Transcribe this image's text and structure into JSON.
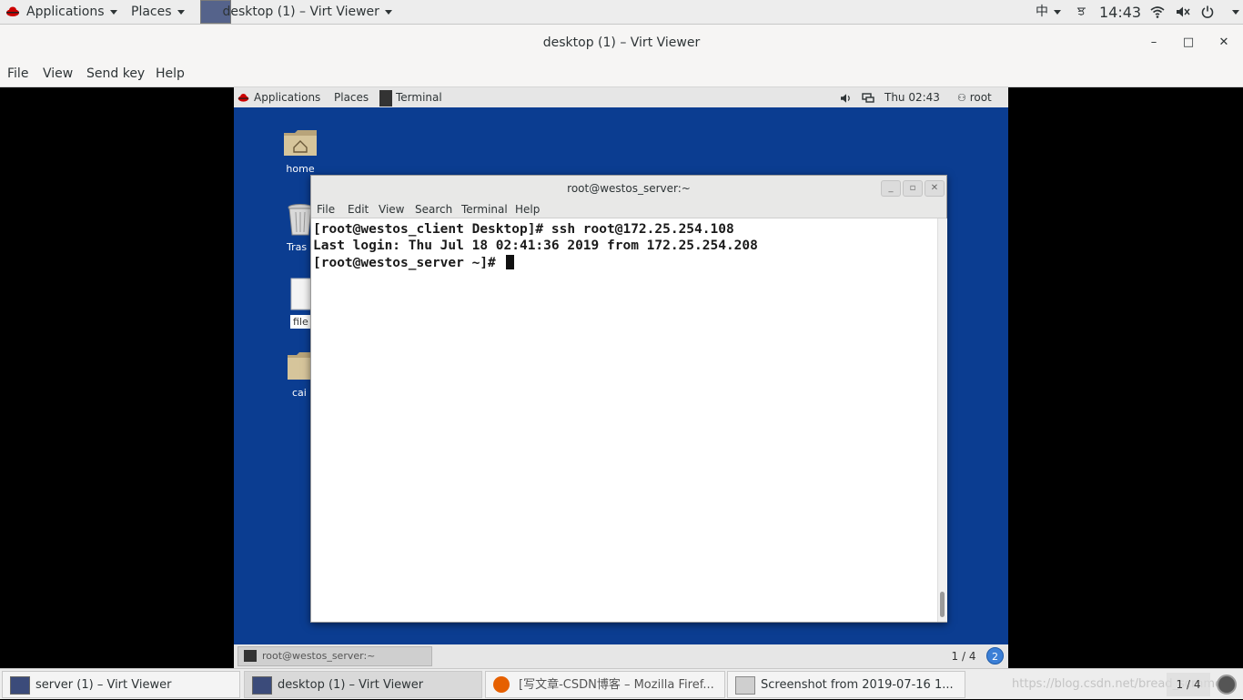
{
  "host_topbar": {
    "applications": "Applications",
    "places": "Places",
    "window_title": "desktop (1) – Virt Viewer",
    "input_method": "中",
    "keyboard": "ਝ",
    "clock": "14:43"
  },
  "virt_viewer": {
    "title": "desktop (1) – Virt Viewer",
    "menu": [
      "File",
      "View",
      "Send key",
      "Help"
    ],
    "minimize": "–",
    "maximize": "□",
    "close": "✕"
  },
  "guest": {
    "topbar": {
      "applications": "Applications",
      "places": "Places",
      "terminal": "Terminal",
      "clock": "Thu 02:43",
      "user": "root"
    },
    "desktop_icons": [
      "home",
      "Tras",
      "file",
      "cai"
    ],
    "terminal": {
      "title": "root@westos_server:~",
      "menu": [
        "File",
        "Edit",
        "View",
        "Search",
        "Terminal",
        "Help"
      ],
      "lines": [
        "[root@westos_client Desktop]# ssh root@172.25.254.108",
        "Last login: Thu Jul 18 02:41:36 2019 from 172.25.254.208",
        "[root@westos_server ~]# "
      ]
    },
    "bottombar": {
      "task": "root@westos_server:~",
      "workspace": "1 / 4",
      "badge": "2"
    }
  },
  "host_taskbar": {
    "tasks": [
      "server (1) – Virt Viewer",
      "desktop (1) – Virt Viewer",
      "[写文章-CSDN博客 – Mozilla Firef...",
      "Screenshot from 2019-07-16 1..."
    ],
    "watermark": "https://blog.csdn.net/bread_scrnmer",
    "workspace": "1 / 4"
  },
  "colors": {
    "guest_desktop": "#0b3d91",
    "panel": "#ededed",
    "redhat": "#cc0000"
  }
}
